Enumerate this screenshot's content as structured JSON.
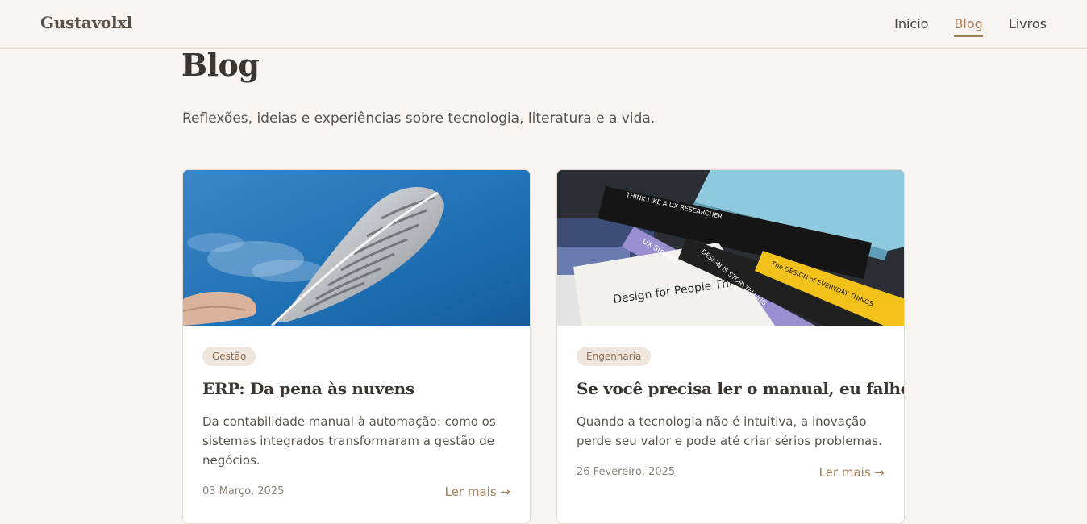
{
  "header": {
    "brand": "Gustavolxl",
    "nav": [
      {
        "label": "Inicio",
        "active": false
      },
      {
        "label": "Blog",
        "active": true
      },
      {
        "label": "Livros",
        "active": false
      }
    ]
  },
  "page": {
    "title": "Blog",
    "subtitle": "Reflexões, ideias e experiências sobre tecnologia, literatura e a vida."
  },
  "posts": [
    {
      "tag": "Gestão",
      "title": "ERP: Da pena às nuvens",
      "excerpt": "Da contabilidade manual à automação: como os sistemas integrados transformaram a gestão de negócios.",
      "date": "03 Março, 2025",
      "read_more": "Ler mais →",
      "image": "feather-against-blue-sky"
    },
    {
      "tag": "Engenharia",
      "title": "Se você precisa ler o manual, eu falhei",
      "excerpt": "Quando a tecnologia não é intuitiva, a inovação perde seu valor e pode até criar sérios problemas.",
      "date": "26 Fevereiro, 2025",
      "read_more": "Ler mais →",
      "image": "stack-of-ux-books",
      "image_text": {
        "book1": "THINK LIKE A UX RESEARCHER",
        "book2": "UX Strategy",
        "book3": "DESIGN IS STORYTELLING",
        "book4": "The DESIGN of EVERYDAY THINGS",
        "book5": "Design for People Thi"
      }
    }
  ],
  "colors": {
    "background": "#f8f4f1",
    "accent": "#a6805a",
    "tag_bg": "#efe6de",
    "text": "#3b3530"
  }
}
